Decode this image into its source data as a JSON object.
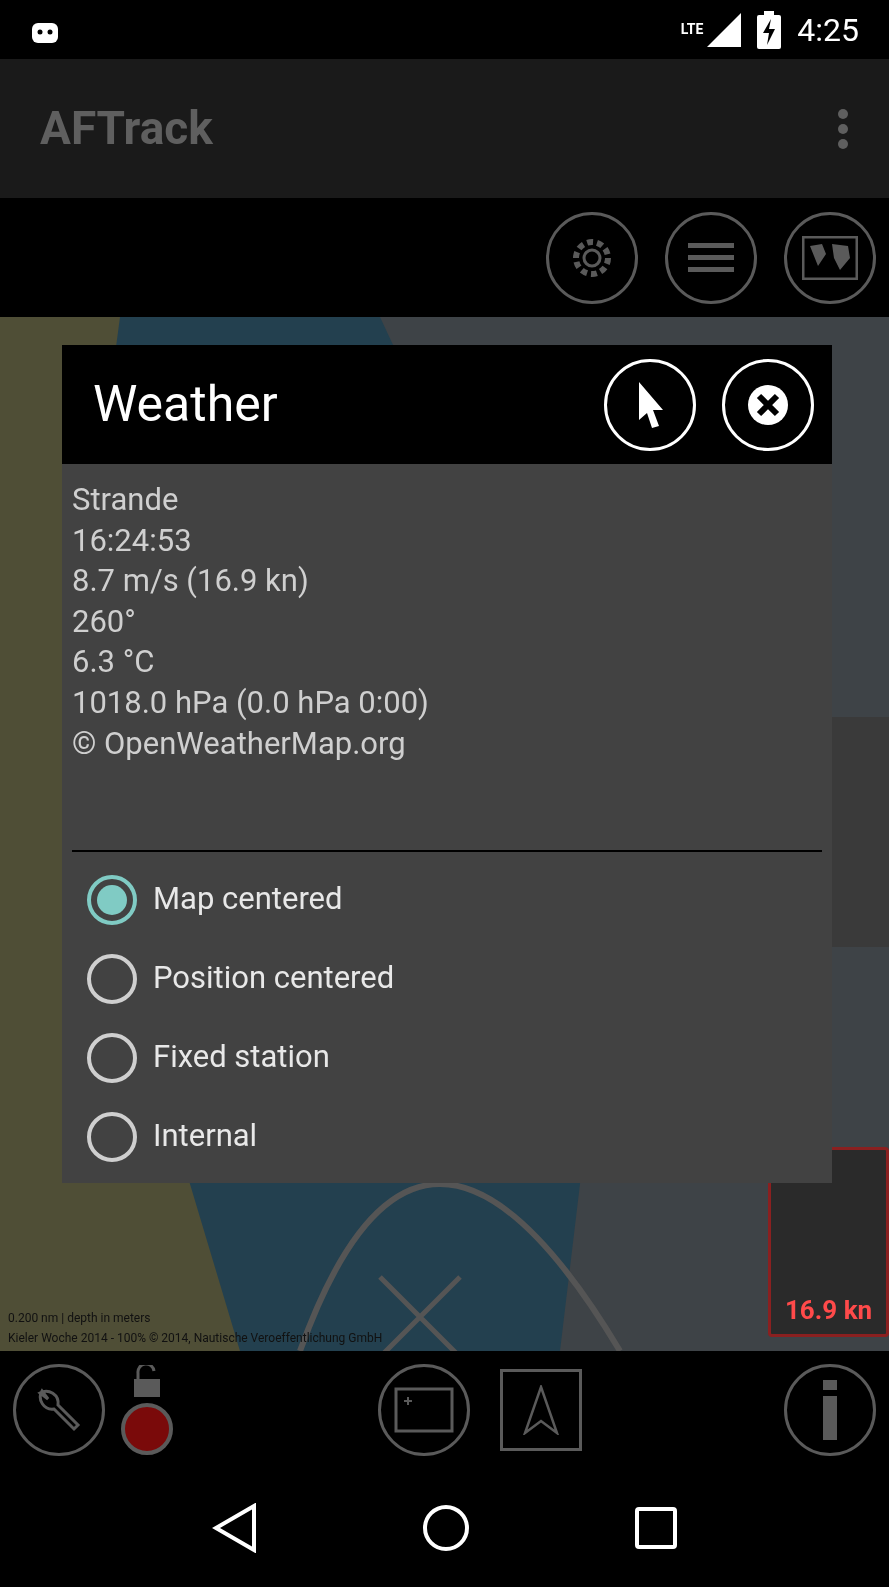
{
  "status_bar": {
    "network": "LTE",
    "time": "4:25"
  },
  "app_bar": {
    "title": "AFTrack"
  },
  "map": {
    "speed": "16.9 kn",
    "scale": "0.200 nm | depth in meters",
    "attribution": "Kieler Woche 2014 - 100% © 2014, Nautische Veroeffentlichung GmbH"
  },
  "dialog": {
    "title": "Weather",
    "info_lines": [
      "Strande",
      "16:24:53",
      "8.7 m/s (16.9 kn)",
      "260°",
      "6.3 °C",
      "1018.0 hPa (0.0 hPa 0:00)",
      "© OpenWeatherMap.org"
    ],
    "options": [
      {
        "label": "Map centered",
        "selected": true
      },
      {
        "label": "Position centered",
        "selected": false
      },
      {
        "label": "Fixed station",
        "selected": false
      },
      {
        "label": "Internal",
        "selected": false
      }
    ]
  },
  "bottom_bar": {
    "recording": true
  }
}
